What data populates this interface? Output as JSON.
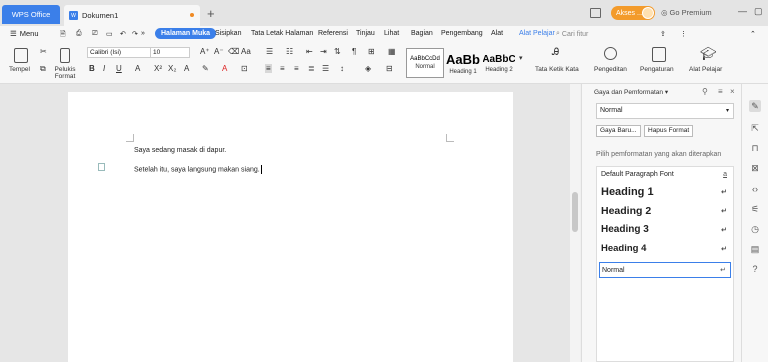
{
  "titlebar": {
    "app_tab": "WPS Office",
    "doc_tab": "Dokumen1",
    "doc_icon": "W",
    "add_tab": "+",
    "akses": "Akses ...",
    "go_premium": "Go Premium"
  },
  "menubar": {
    "menu": "Menu",
    "tabs": [
      "Halaman Muka",
      "Sisipkan",
      "Tata Letak Halaman",
      "Referensi",
      "Tinjau",
      "Lihat",
      "Bagian",
      "Pengembang",
      "Alat",
      "Alat Pelajar"
    ],
    "search_placeholder": "Cari fitur"
  },
  "ribbon": {
    "paste": "Tempel",
    "format_painter": "Pelukis Format",
    "font_name": "Calibri (Isi)",
    "font_size": "10",
    "styles": [
      {
        "preview": "AaBbCcDd",
        "label": "Normal"
      },
      {
        "preview": "AaBb",
        "label": "Heading 1"
      },
      {
        "preview": "AaBbC",
        "label": "Heading 2"
      }
    ],
    "text_direction": "Tata Ketik Kata",
    "editing": "Pengeditan",
    "settings": "Pengaturan",
    "learning_tools": "Alat Pelajar"
  },
  "document": {
    "lines": [
      "Saya sedang masak di dapur.",
      "Setelah itu, saya langsung makan siang."
    ]
  },
  "pane": {
    "title": "Gaya dan Pemformatan",
    "current_style": "Normal",
    "new_style_btn": "Gaya Baru...",
    "clear_format_btn": "Hapus Format",
    "hint": "Pilih pemformatan yang akan diterapkan",
    "styles": [
      {
        "name": "Default Paragraph Font",
        "mark": "a"
      },
      {
        "name": "Heading 1",
        "mark": "↵"
      },
      {
        "name": "Heading 2",
        "mark": "↵"
      },
      {
        "name": "Heading 3",
        "mark": "↵"
      },
      {
        "name": "Heading 4",
        "mark": "↵"
      },
      {
        "name": "Normal",
        "mark": "↵"
      }
    ]
  },
  "colors": {
    "accent": "#3b7fe9",
    "akses": "#f39b2b"
  }
}
